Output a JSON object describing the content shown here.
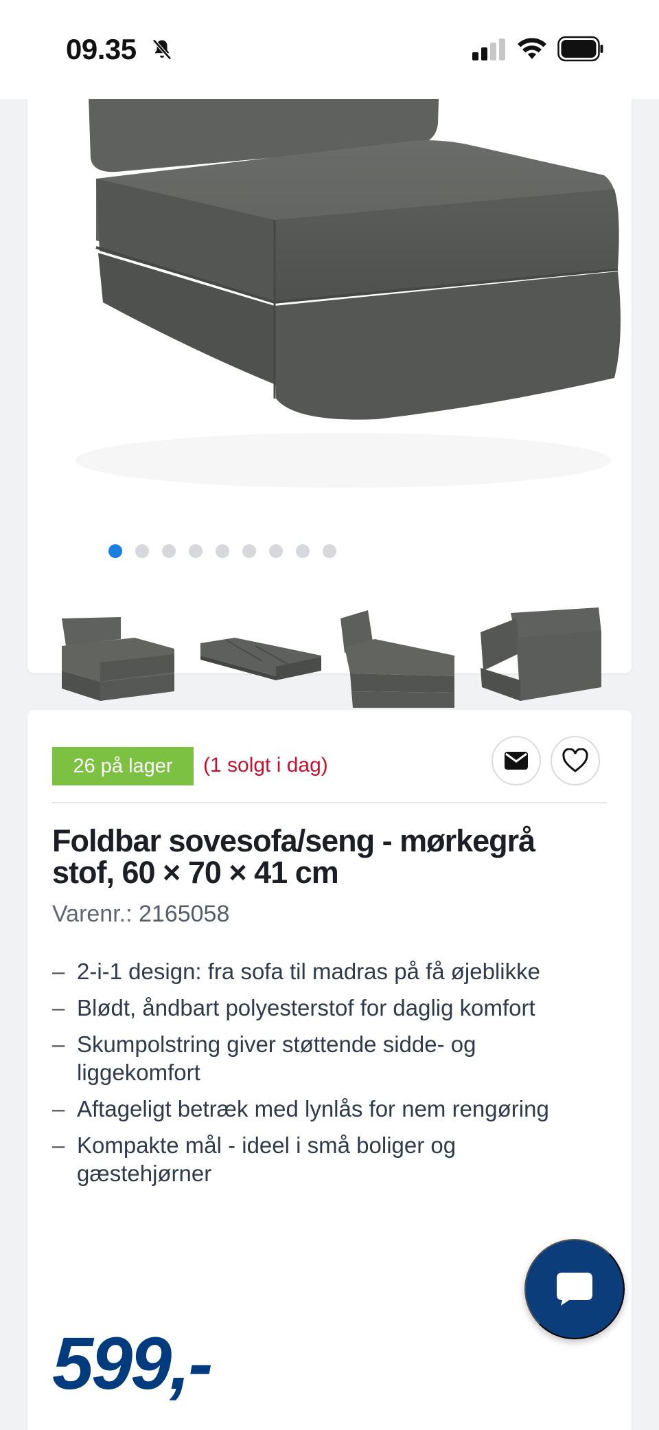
{
  "status_bar": {
    "time": "09.35"
  },
  "gallery": {
    "dot_count": 9,
    "active_dot": 0,
    "thumbnail_count": 4
  },
  "product": {
    "stock_label": "26 på lager",
    "sold_today": "(1 solgt i dag)",
    "title": "Foldbar sovesofa/seng - mørkegrå stof, 60 × 70 × 41 cm",
    "sku_label": "Varenr.:",
    "sku_value": "2165058",
    "features": [
      "2-i-1 design: fra sofa til madras på få øjeblikke",
      "Blødt, åndbart polyesterstof for daglig komfort",
      "Skumpolstring giver støttende sidde- og liggekomfort",
      "Aftageligt betræk med lynlås for nem rengøring",
      "Kompakte mål - ideel i små boliger og gæstehjørner"
    ],
    "price": "599,-"
  },
  "colors": {
    "stock_badge": "#7dc142",
    "sold_text": "#c8102e",
    "price": "#003b7e",
    "active_dot": "#1a7fe0",
    "chat_button": "#0b3d7a"
  },
  "icons": {
    "bell": "bell-slash-icon",
    "signal": "cellular-signal-icon",
    "wifi": "wifi-icon",
    "battery": "battery-icon",
    "mail": "envelope-icon",
    "favorite": "heart-icon",
    "chat": "chat-bubble-icon"
  }
}
